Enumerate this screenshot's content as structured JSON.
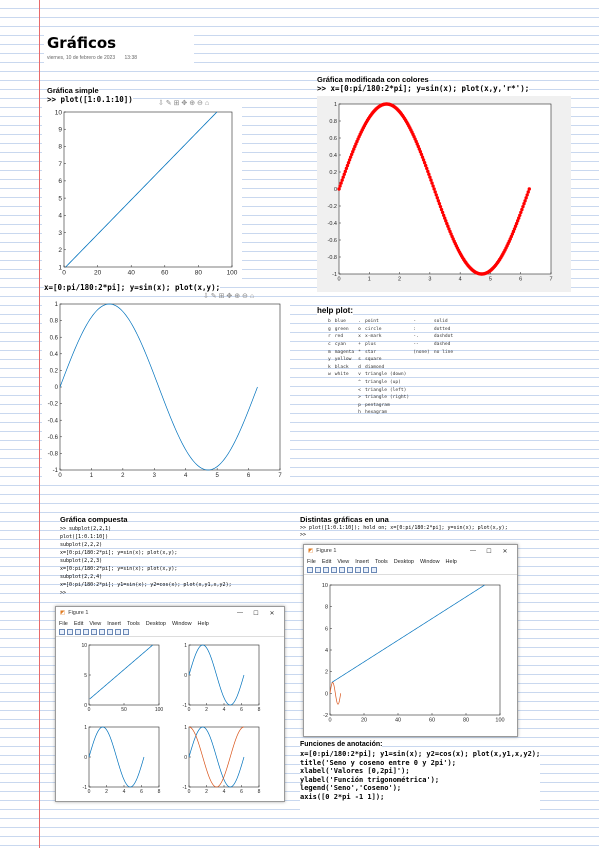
{
  "page": {
    "title": "Gráficos",
    "date": "viernes, 10 de febrero de 2023",
    "time": "13:38"
  },
  "simple": {
    "heading": "Gráfica simple",
    "command": ">> plot([1:0.1:10])",
    "toolbar_icons": [
      "save-icon",
      "brush-icon",
      "data-tips-icon",
      "pan-icon",
      "zoom-in-icon",
      "zoom-out-icon",
      "home-icon"
    ],
    "toolbar_text": "⇩ ✎ ⊞ ✥ ⊕ ⊖ ⌂"
  },
  "sine_plot": {
    "command": "x=[0:pi/180:2*pi]; y=sin(x); plot(x,y);",
    "toolbar_text": "⇩ ✎ ⊞ ✥ ⊕ ⊖ ⌂"
  },
  "colored": {
    "heading": "Gráfica modificada con colores",
    "command": ">> x=[0:pi/180:2*pi]; y=sin(x); plot(x,y,'r*');"
  },
  "help": {
    "heading": "help plot:",
    "rows": [
      [
        "b",
        "blue",
        ".",
        "point",
        "-",
        "solid"
      ],
      [
        "g",
        "green",
        "o",
        "circle",
        ":",
        "dotted"
      ],
      [
        "r",
        "red",
        "x",
        "x-mark",
        "-.",
        "dashdot"
      ],
      [
        "c",
        "cyan",
        "+",
        "plus",
        "--",
        "dashed"
      ],
      [
        "m",
        "magenta",
        "*",
        "star",
        "(none)",
        "no line"
      ],
      [
        "y",
        "yellow",
        "s",
        "square",
        "",
        ""
      ],
      [
        "k",
        "black",
        "d",
        "diamond",
        "",
        ""
      ],
      [
        "w",
        "white",
        "v",
        "triangle (down)",
        "",
        ""
      ],
      [
        "",
        "",
        "^",
        "triangle (up)",
        "",
        ""
      ],
      [
        "",
        "",
        "<",
        "triangle (left)",
        "",
        ""
      ],
      [
        "",
        "",
        ">",
        "triangle (right)",
        "",
        ""
      ],
      [
        "",
        "",
        "p",
        "pentagram",
        "",
        ""
      ],
      [
        "",
        "",
        "h",
        "hexagram",
        "",
        ""
      ]
    ]
  },
  "compuesta": {
    "heading": "Gráfica compuesta",
    "code": [
      ">> subplot(2,2,1)",
      "plot([1:0.1:10])",
      "subplot(2,2,2)",
      "x=[0:pi/180:2*pi]; y=sin(x); plot(x,y);",
      "subplot(2,2,3)",
      "x=[0:pi/180:2*pi]; y=sin(x); plot(x,y);",
      "subplot(2,2,4)",
      "x=[0:pi/180:2*pi]; y1=sin(x); y2=cos(x); plot(x,y1,x,y2);",
      ">>"
    ],
    "window": {
      "title": "Figure 1",
      "menu": [
        "File",
        "Edit",
        "View",
        "Insert",
        "Tools",
        "Desktop",
        "Window",
        "Help"
      ]
    }
  },
  "distintas": {
    "heading": "Distintas gráficas en una",
    "code": [
      ">> plot([1:0.1:10]); hold on; x=[0:pi/180:2*pi]; y=sin(x); plot(x,y);",
      ">>"
    ],
    "window": {
      "title": "Figure 1",
      "menu": [
        "File",
        "Edit",
        "View",
        "Insert",
        "Tools",
        "Desktop",
        "Window",
        "Help"
      ]
    }
  },
  "anotacion": {
    "heading": "Funciones de anotación:",
    "lines": [
      "x=[0:pi/180:2*pi]; y1=sin(x); y2=cos(x); plot(x,y1,x,y2);",
      "title('Seno y coseno entre 0 y 2pi');",
      "xlabel('Valores [0,2pi]');",
      "ylabel('Función trigonométrica');",
      "legend('Seno','Coseno');",
      "axis([0 2*pi -1 1]);"
    ]
  },
  "colors": {
    "blue": "#0072bd",
    "red": "#ff0000",
    "orange": "#d95319",
    "margin": "#e86a6a",
    "ruled": "#c9d8ef"
  },
  "chart_data": [
    {
      "id": "simple",
      "type": "line",
      "x_range": [
        1,
        91
      ],
      "y_values": "1:0.1:10",
      "xlim": [
        0,
        100
      ],
      "ylim": [
        1,
        10
      ],
      "xticks": [
        "0",
        "20",
        "40",
        "60",
        "80",
        "100"
      ],
      "yticks": [
        "1",
        "2",
        "3",
        "4",
        "5",
        "6",
        "7",
        "8",
        "9",
        "10"
      ]
    },
    {
      "id": "sine",
      "type": "line",
      "function": "sin(x)",
      "x_range": [
        0,
        6.2832
      ],
      "xlim": [
        0,
        7
      ],
      "ylim": [
        -1,
        1
      ],
      "xticks": [
        "0",
        "1",
        "2",
        "3",
        "4",
        "5",
        "6",
        "7"
      ],
      "yticks": [
        "-1",
        "-0.8",
        "-0.6",
        "-0.4",
        "-0.2",
        "0",
        "0.2",
        "0.4",
        "0.6",
        "0.8",
        "1"
      ]
    },
    {
      "id": "colored",
      "type": "scatter",
      "function": "sin(x)",
      "marker": "*",
      "x_range": [
        0,
        6.2832
      ],
      "xlim": [
        0,
        7
      ],
      "ylim": [
        -1,
        1
      ],
      "xticks": [
        "0",
        "1",
        "2",
        "3",
        "4",
        "5",
        "6",
        "7"
      ],
      "yticks": [
        "-1",
        "-0.8",
        "-0.6",
        "-0.4",
        "-0.2",
        "0",
        "0.2",
        "0.4",
        "0.6",
        "0.8",
        "1"
      ]
    },
    {
      "id": "subplot-1",
      "type": "line",
      "y_values": "1:0.1:10",
      "xlim": [
        0,
        100
      ],
      "ylim": [
        0,
        10
      ],
      "xticks": [
        "0",
        "50",
        "100"
      ],
      "yticks": [
        "0",
        "5",
        "10"
      ]
    },
    {
      "id": "subplot-2",
      "type": "line",
      "function": "sin(x)",
      "xlim": [
        0,
        8
      ],
      "ylim": [
        -1,
        1
      ],
      "xticks": [
        "0",
        "2",
        "4",
        "6",
        "8"
      ],
      "yticks": [
        "-1",
        "0",
        "1"
      ]
    },
    {
      "id": "subplot-3",
      "type": "line",
      "function": "sin(x)",
      "xlim": [
        0,
        8
      ],
      "ylim": [
        -1,
        1
      ],
      "xticks": [
        "0",
        "2",
        "4",
        "6",
        "8"
      ],
      "yticks": [
        "-1",
        "0",
        "1"
      ]
    },
    {
      "id": "subplot-4",
      "type": "line",
      "series": [
        {
          "function": "sin(x)"
        },
        {
          "function": "cos(x)"
        }
      ],
      "xlim": [
        0,
        8
      ],
      "ylim": [
        -1,
        1
      ],
      "xticks": [
        "0",
        "2",
        "4",
        "6",
        "8"
      ],
      "yticks": [
        "-1",
        "0",
        "1"
      ]
    },
    {
      "id": "combined",
      "type": "line",
      "series": [
        {
          "y_values": "1:0.1:10"
        },
        {
          "function": "sin(x)"
        }
      ],
      "xlim": [
        0,
        100
      ],
      "ylim": [
        -2,
        10
      ],
      "xticks": [
        "0",
        "20",
        "40",
        "60",
        "80",
        "100"
      ],
      "yticks": [
        "-2",
        "0",
        "2",
        "4",
        "6",
        "8",
        "10"
      ]
    }
  ]
}
